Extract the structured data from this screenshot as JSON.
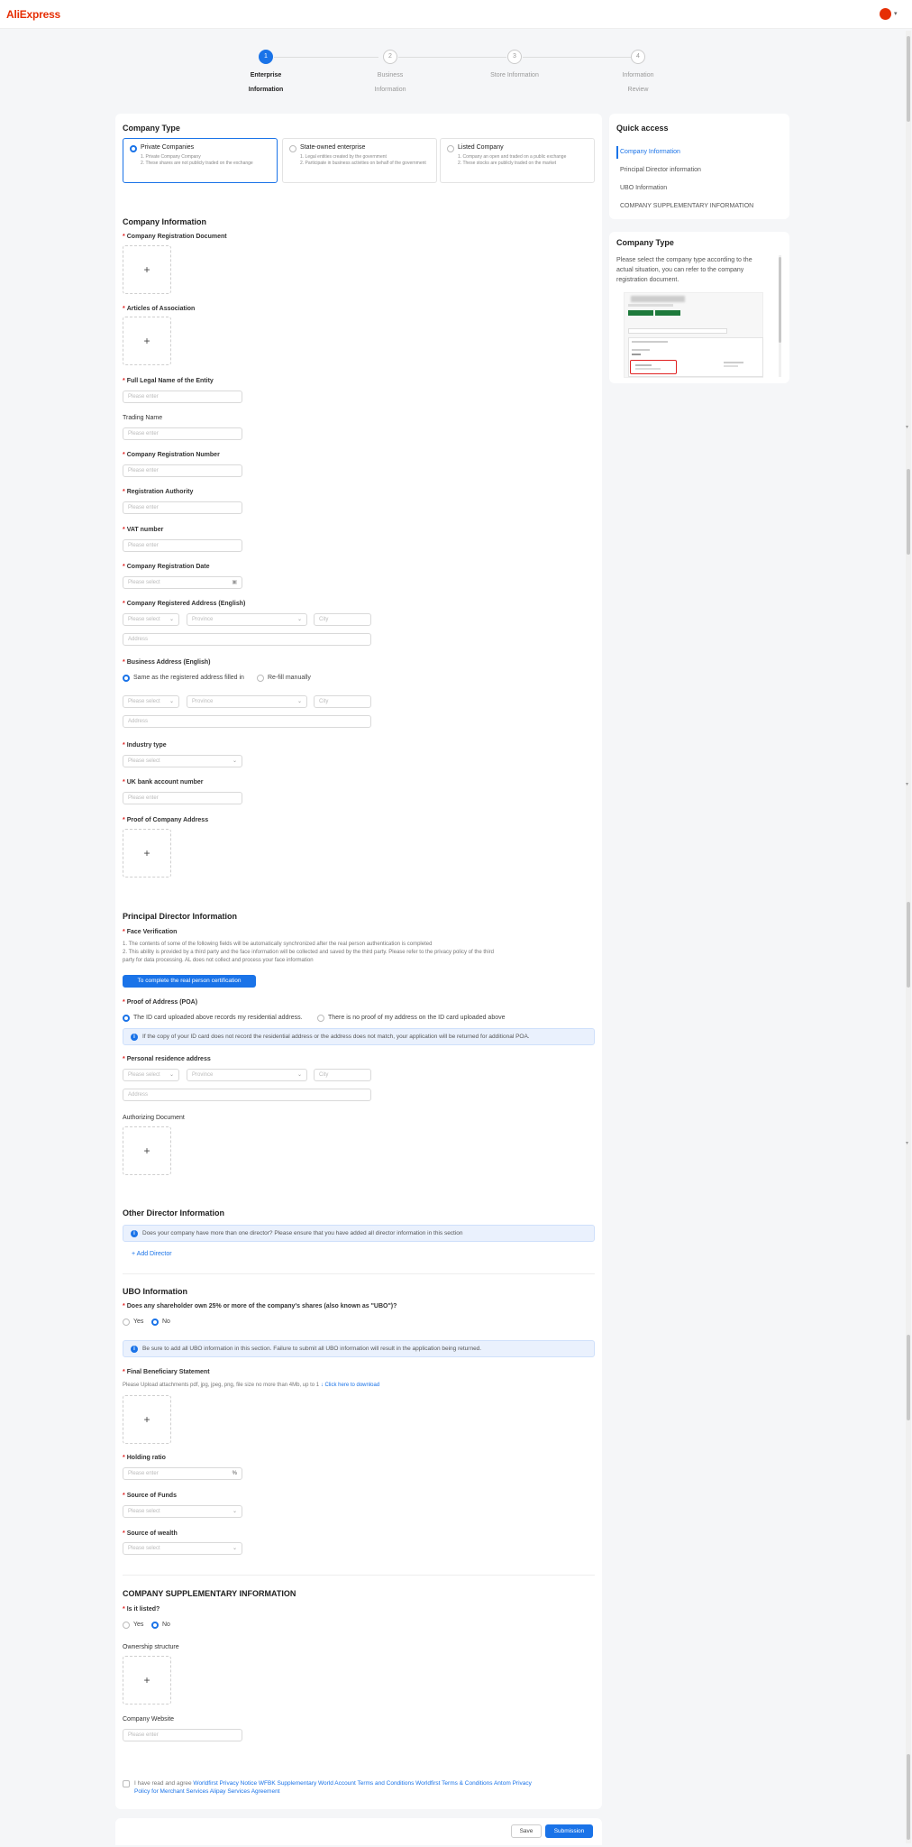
{
  "header": {
    "logo": "AliExpress"
  },
  "steps": [
    {
      "num": "1",
      "label_line1": "Enterprise",
      "label_line2": "Information"
    },
    {
      "num": "2",
      "label_line1": "Business",
      "label_line2": "Information"
    },
    {
      "num": "3",
      "label_line1": "Store Information",
      "label_line2": ""
    },
    {
      "num": "4",
      "label_line1": "Information",
      "label_line2": "Review"
    }
  ],
  "company_type": {
    "title": "Company Type",
    "options": [
      {
        "title": "Private Companies",
        "desc1": "1. Private Company Company",
        "desc2": "2. These shares are not publicly traded on the exchange"
      },
      {
        "title": "State-owned enterprise",
        "desc1": "1. Legal entities created by the government",
        "desc2": "2. Participate in business activities on behalf of the government"
      },
      {
        "title": "Listed Company",
        "desc1": "1. Company an open and traded on a public exchange",
        "desc2": "2. These stocks are publicly traded on the market"
      }
    ]
  },
  "company_info": {
    "title": "Company Information",
    "reg_doc": "Company Registration Document",
    "articles": "Articles of Association",
    "legal_name": "Full Legal Name of the Entity",
    "trading_name": "Trading Name",
    "reg_number": "Company Registration Number",
    "reg_authority": "Registration Authority",
    "vat": "VAT number",
    "reg_date": "Company Registration Date",
    "reg_address": "Company Registered Address (English)",
    "business_address": "Business Address (English)",
    "same_as": "Same as the registered address filled in",
    "refill": "Re-fill manually",
    "industry": "Industry type",
    "bank": "UK bank account number",
    "proof_address": "Proof of Company Address"
  },
  "placeholders": {
    "enter": "Please enter",
    "select": "Please select",
    "province": "Province",
    "city": "City",
    "address": "Address"
  },
  "principal": {
    "title": "Principal Director Information",
    "face": "Face Verification",
    "note1": "1. The contents of some of the following fields will be automatically synchronized after the real person authentication is completed",
    "note2": "2. This ability is provided by a third party and the face information will be collected and saved by the third party. Please refer to the privacy policy of the third",
    "note3": "party for data processing. AL does not collect and process your face information",
    "cert_button": "To complete the real person certification",
    "poa": "Proof of Address (POA)",
    "poa_opt1": "The ID card uploaded above records my residential address.",
    "poa_opt2": "There is no proof of my address on the ID card uploaded above",
    "poa_alert": "If the copy of your ID card does not record the residential address or the address does not match, your application will be returned for additional POA.",
    "residence": "Personal residence address",
    "authorizing": "Authorizing Document"
  },
  "other_director": {
    "title": "Other Director Information",
    "alert": "Does your company have more than one director? Please ensure that you have added all director information in this section",
    "add": "+ Add Director"
  },
  "ubo": {
    "title": "UBO Information",
    "question": "Does any shareholder own 25% or more of the company's shares (also known as \"UBO\")?",
    "yes": "Yes",
    "no": "No",
    "alert": "Be sure to add all UBO information in this section. Failure to submit all UBO information will result in the application being returned.",
    "statement": "Final Beneficiary Statement",
    "statement_note": "Please Upload attachments pdf, jpg, jpeg, png, file size no more than 4Mb, up to 1",
    "download": "Click here to download",
    "holding": "Holding ratio",
    "percent": "%",
    "funds": "Source of Funds",
    "wealth": "Source of wealth"
  },
  "supplementary": {
    "title": "COMPANY SUPPLEMENTARY INFORMATION",
    "listed": "Is it listed?",
    "yes": "Yes",
    "no": "No",
    "ownership": "Ownership structure",
    "website": "Company Website"
  },
  "agreement": {
    "prefix": "I have read and agree",
    "links1": "Worldfirst Privacy Notice WFBK Supplementary World Account Terms and Conditions Worldfirst Terms & Conditions Antom Privacy",
    "links2": "Policy for Merchant Services Alipay Services Agreement"
  },
  "footer": {
    "save": "Save",
    "submit": "Submission"
  },
  "quick_access": {
    "title": "Quick access",
    "items": [
      "Company Information",
      "Principal Director information",
      "UBO Information",
      "COMPANY SUPPLEMENTARY INFORMATION"
    ]
  },
  "company_type_help": {
    "title": "Company Type",
    "text": "Please select the company type according to the actual situation, you can refer to the company registration document."
  },
  "colors": {
    "accent": "#1a73e8",
    "brand": "#e62e04",
    "required": "#e02020"
  }
}
